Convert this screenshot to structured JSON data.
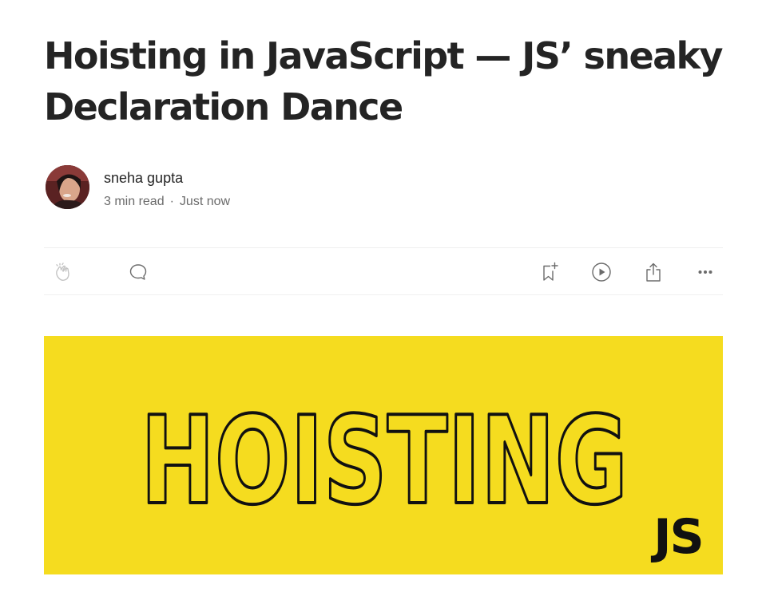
{
  "article": {
    "title": "Hoisting in JavaScript — JS’ sneaky Declaration Dance"
  },
  "author": {
    "name": "sneha gupta",
    "read_time": "3 min read",
    "separator": "·",
    "published": "Just now"
  },
  "actions": {
    "left": [
      "clap-icon",
      "comment-icon"
    ],
    "right": [
      "bookmark-add-icon",
      "listen-play-icon",
      "share-icon",
      "more-icon"
    ]
  },
  "hero_image": {
    "main_text": "HOISTING",
    "corner_text": "JS",
    "background_color": "#f5dc1f",
    "text_color": "#111111"
  },
  "colors": {
    "title": "#242424",
    "meta": "#6b6b6b",
    "icon": "#6b6b6b",
    "icon_muted": "#c4c4c4"
  }
}
